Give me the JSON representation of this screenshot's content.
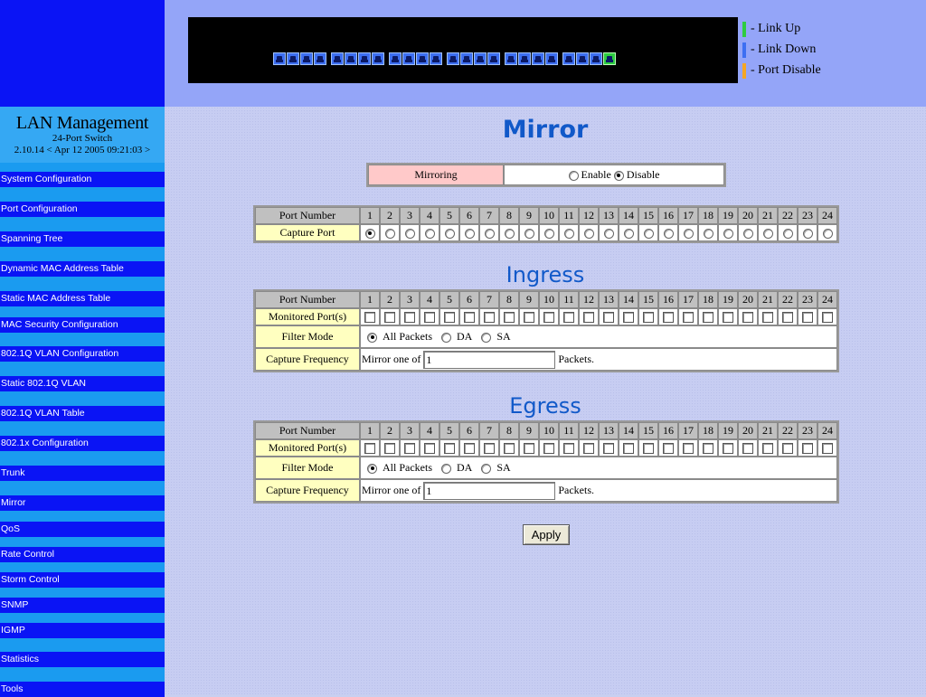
{
  "sidebar": {
    "title": "LAN Management",
    "subtitle": "24-Port Switch",
    "version": "2.10.14 < Apr 12 2005 09:21:03 >",
    "items": [
      "System Configuration",
      "Port Configuration",
      "Spanning Tree",
      "Dynamic MAC Address Table",
      "Static MAC Address Table",
      "MAC Security Configuration",
      "802.1Q VLAN Configuration",
      "Static 802.1Q VLAN",
      "802.1Q VLAN Table",
      "802.1x Configuration",
      "Trunk",
      "Mirror",
      "QoS",
      "Rate Control",
      "Storm Control",
      "SNMP",
      "IGMP",
      "Statistics",
      "Tools"
    ]
  },
  "switch_panel": {
    "port_groups": [
      4,
      4,
      4,
      4,
      4,
      4
    ],
    "ports_up": [
      24
    ],
    "colors": {
      "link_up": "#2ecc40",
      "link_down": "#3d6ff2",
      "port_disable": "#f5a623"
    }
  },
  "legend": {
    "link_up": "- Link Up",
    "link_down": "- Link Down",
    "port_disable": "- Port Disable"
  },
  "main": {
    "title": "Mirror",
    "mirroring": {
      "label": "Mirroring",
      "enable_label": "Enable",
      "disable_label": "Disable",
      "selected": "Disable"
    },
    "port_number_label": "Port Number",
    "ports": [
      "1",
      "2",
      "3",
      "4",
      "5",
      "6",
      "7",
      "8",
      "9",
      "10",
      "11",
      "12",
      "13",
      "14",
      "15",
      "16",
      "17",
      "18",
      "19",
      "20",
      "21",
      "22",
      "23",
      "24"
    ],
    "capture_port": {
      "label": "Capture Port",
      "selected": "1"
    },
    "ingress": {
      "title": "Ingress",
      "monitored_label": "Monitored Port(s)",
      "monitored_ports": [],
      "filter_mode_label": "Filter Mode",
      "filter_options": [
        "All Packets",
        "DA",
        "SA"
      ],
      "filter_selected": "All Packets",
      "capture_frequency_label": "Capture Frequency",
      "mirror_one_of": "Mirror one of",
      "frequency_value": "1",
      "packets_label": "Packets."
    },
    "egress": {
      "title": "Egress",
      "monitored_label": "Monitored Port(s)",
      "monitored_ports": [],
      "filter_mode_label": "Filter Mode",
      "filter_options": [
        "All Packets",
        "DA",
        "SA"
      ],
      "filter_selected": "All Packets",
      "capture_frequency_label": "Capture Frequency",
      "mirror_one_of": "Mirror one of",
      "frequency_value": "1",
      "packets_label": "Packets."
    },
    "apply_label": "Apply"
  }
}
